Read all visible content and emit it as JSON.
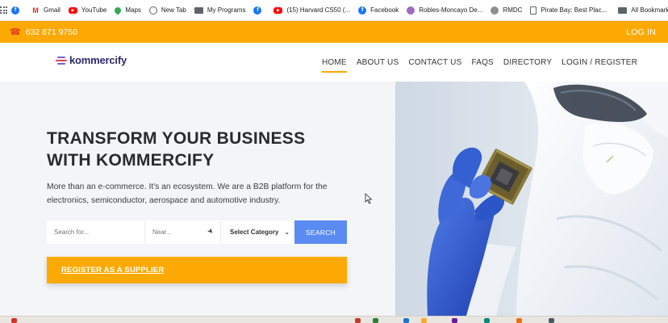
{
  "bookmarks": {
    "items": [
      {
        "label": "",
        "icon": "facebook-icon"
      },
      {
        "label": "Gmail",
        "icon": "gmail-icon"
      },
      {
        "label": "YouTube",
        "icon": "youtube-icon"
      },
      {
        "label": "Maps",
        "icon": "maps-icon"
      },
      {
        "label": "New Tab",
        "icon": "globe-icon"
      },
      {
        "label": "My Programs",
        "icon": "folder-icon"
      },
      {
        "label": "",
        "icon": "facebook-icon"
      },
      {
        "label": "(15) Harvard CS50 (...",
        "icon": "youtube-icon"
      },
      {
        "label": "Facebook",
        "icon": "facebook-icon"
      },
      {
        "label": "Robles-Moncayo De...",
        "icon": "site-icon"
      },
      {
        "label": "RMDC",
        "icon": "site-icon"
      },
      {
        "label": "Pirate Bay: Best Plac...",
        "icon": "document-icon"
      }
    ],
    "all_bookmarks": "All Bookmarks"
  },
  "topbar": {
    "phone": "632 871 9750",
    "login": "LOG IN"
  },
  "nav": {
    "logo": "kommercify",
    "menu": [
      "HOME",
      "ABOUT US",
      "CONTACT US",
      "FAQS",
      "DIRECTORY",
      "LOGIN / REGISTER"
    ],
    "active": "HOME"
  },
  "hero": {
    "title_line1": "TRANSFORM YOUR BUSINESS",
    "title_line2": "WITH KOMMERCIFY",
    "subtitle": "More than an e-commerce. It's an ecosystem. We are a B2B platform for the electronics, semiconductor, aerospace and automotive industry."
  },
  "search": {
    "query_placeholder": "Search for...",
    "near_placeholder": "Near...",
    "category": "Select Category",
    "button": "SEARCH"
  },
  "register": {
    "label": "REGISTER AS A SUPPLIER"
  },
  "colors": {
    "accent": "#fca903",
    "search_button": "#5a8bf2",
    "logo": "#2c2a6b"
  }
}
